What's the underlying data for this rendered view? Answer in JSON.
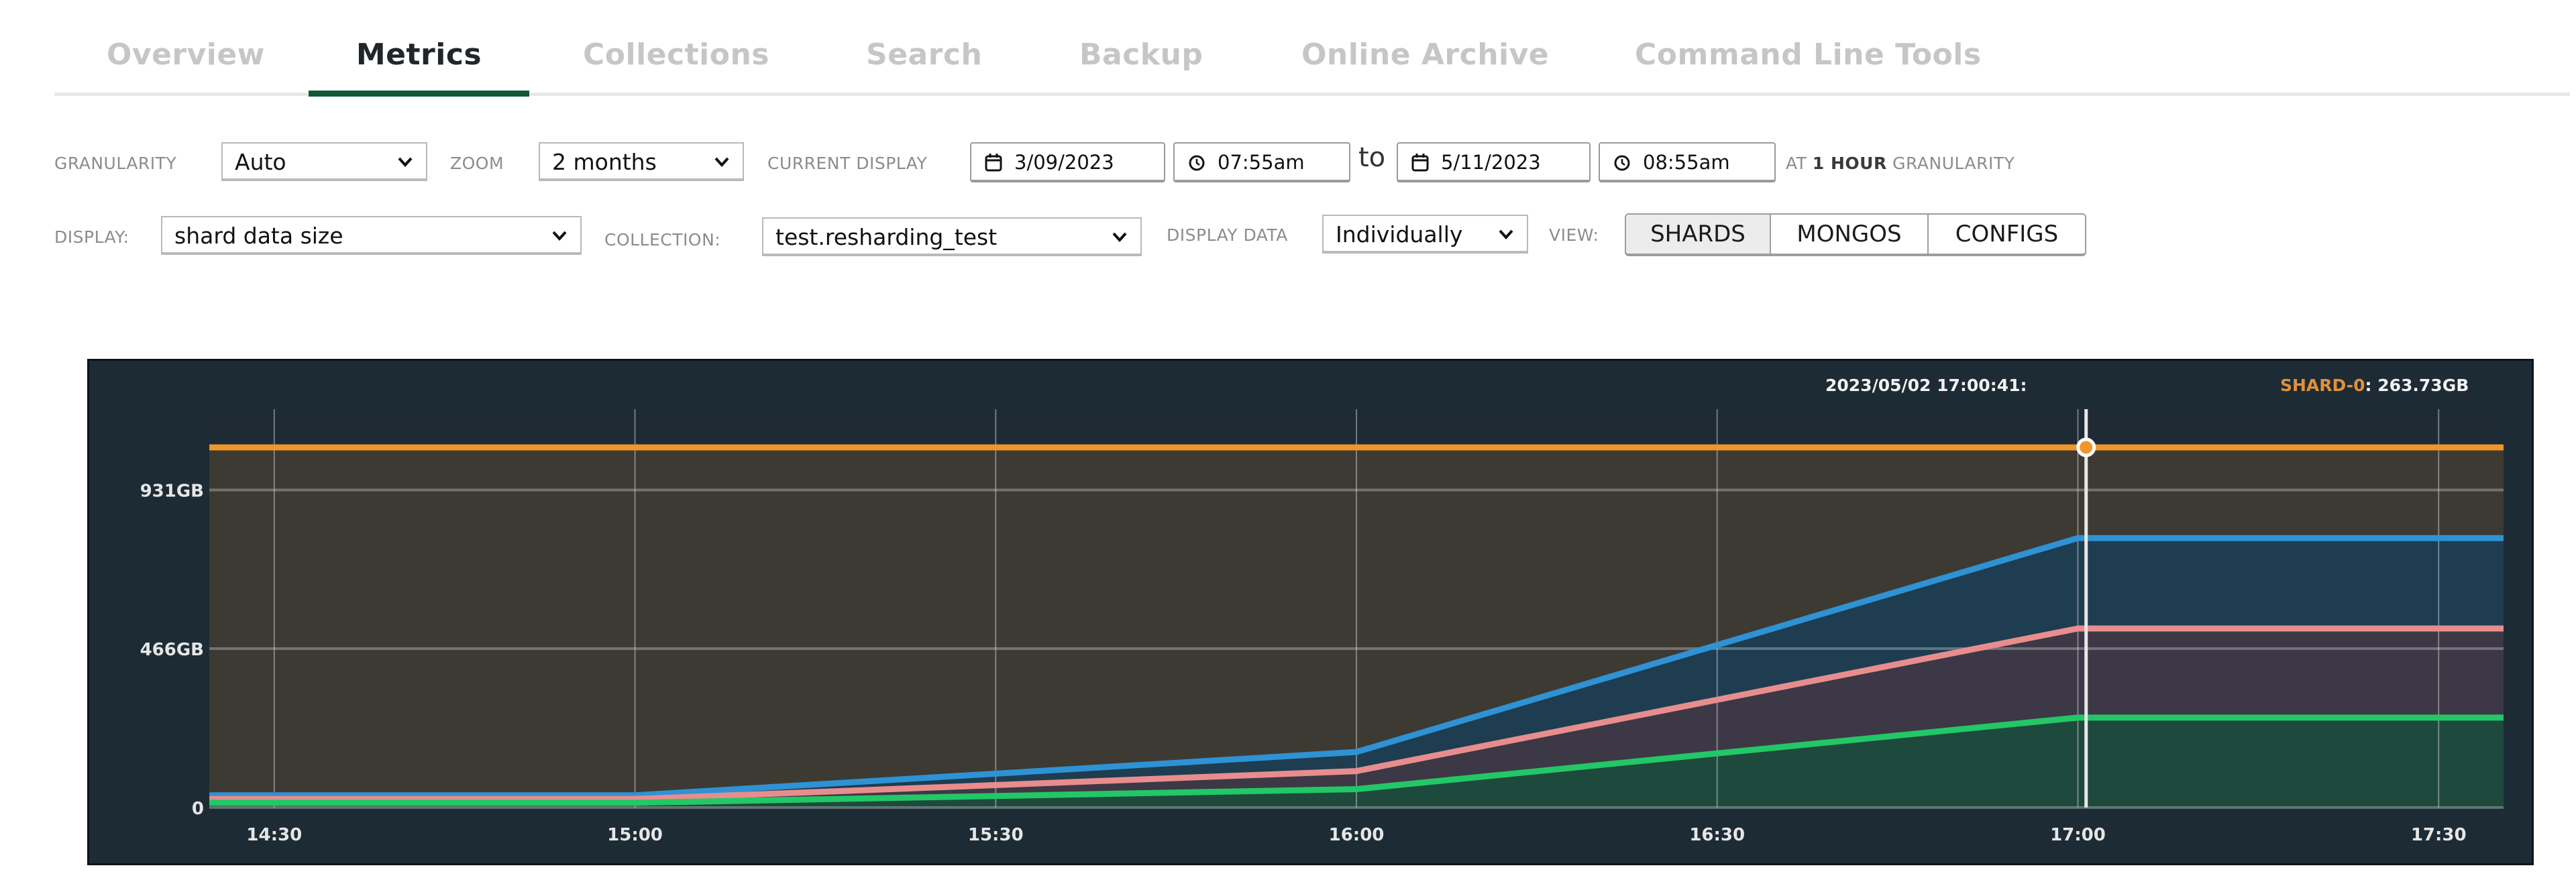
{
  "tabs": [
    {
      "label": "Overview",
      "active": false
    },
    {
      "label": "Metrics",
      "active": true
    },
    {
      "label": "Collections",
      "active": false
    },
    {
      "label": "Search",
      "active": false
    },
    {
      "label": "Backup",
      "active": false
    },
    {
      "label": "Online Archive",
      "active": false
    },
    {
      "label": "Command Line Tools",
      "active": false
    }
  ],
  "controls": {
    "granularity_label": "GRANULARITY",
    "granularity_value": "Auto",
    "zoom_label": "ZOOM",
    "zoom_value": "2 months",
    "current_display_label": "CURRENT DISPLAY",
    "start_date": "3/09/2023",
    "start_time": "07:55am",
    "to_label": "to",
    "end_date": "5/11/2023",
    "end_time": "08:55am",
    "granularity_note_prefix": "AT",
    "granularity_note_value": "1 HOUR",
    "granularity_note_suffix": "GRANULARITY",
    "display_label": "DISPLAY:",
    "display_value": "shard data size",
    "collection_label": "COLLECTION:",
    "collection_value": "test.resharding_test",
    "display_data_label": "DISPLAY DATA",
    "display_data_value": "Individually",
    "view_label": "VIEW:",
    "view_buttons": [
      {
        "label": "SHARDS",
        "active": true
      },
      {
        "label": "MONGOS",
        "active": false
      },
      {
        "label": "CONFIGS",
        "active": false
      }
    ]
  },
  "icons": {
    "calendar": "calendar-icon",
    "clock": "clock-icon",
    "chevron": "chevron-down-icon"
  },
  "hover": {
    "timestamp": "2023/05/02 17:00:41:",
    "series_label": "SHARD-0",
    "value": "263.73GB"
  },
  "chart_data": {
    "type": "area",
    "title": "",
    "xlabel": "",
    "ylabel": "",
    "x_unit": "time (HH:MM)",
    "y_unit": "GB",
    "xlim": [
      "14:24.6",
      "17:35.4"
    ],
    "ylim": [
      0,
      1168
    ],
    "x_ticks": [
      "14:30",
      "15:00",
      "15:30",
      "16:00",
      "16:30",
      "17:00",
      "17:30"
    ],
    "y_ticks": [
      {
        "value": 0,
        "label": "0"
      },
      {
        "value": 466,
        "label": "466GB"
      },
      {
        "value": 931,
        "label": "931GB"
      }
    ],
    "grid": true,
    "legend": "none",
    "x": [
      "14:24.6",
      "15:00",
      "16:00",
      "17:00",
      "17:35.4"
    ],
    "series": [
      {
        "name": "orange",
        "color": "#f0962b",
        "fill": "#3d3a33",
        "values": [
          1056,
          1056,
          1056,
          1056,
          1056
        ]
      },
      {
        "name": "blue",
        "color": "#2e92d4",
        "fill": "#1e3d51",
        "values": [
          36,
          36,
          163,
          790,
          790
        ]
      },
      {
        "name": "pink",
        "color": "#e88d8d",
        "fill": "#3c3845",
        "values": [
          25,
          25,
          107,
          525,
          525
        ]
      },
      {
        "name": "green",
        "color": "#23c766",
        "fill": "#1e4a3e",
        "values": [
          14,
          14,
          54,
          263.73,
          263.73
        ]
      }
    ],
    "cursor": {
      "time": "17:00:41",
      "series": "orange",
      "marker_value": 1056
    }
  }
}
